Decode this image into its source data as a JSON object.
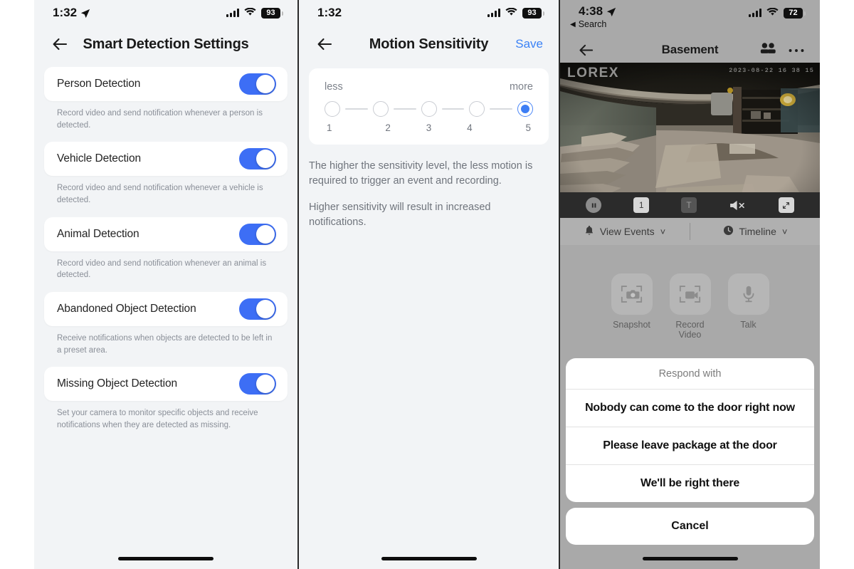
{
  "panels": {
    "smart_detection": {
      "status_bar": {
        "time": "1:32",
        "battery": "93"
      },
      "nav": {
        "title": "Smart Detection Settings",
        "back_icon": "back-arrow-icon"
      },
      "items": [
        {
          "label": "Person Detection",
          "enabled": true,
          "description": "Record video and send notification whenever a person is detected."
        },
        {
          "label": "Vehicle Detection",
          "enabled": true,
          "description": "Record video and send notification whenever a vehicle is detected."
        },
        {
          "label": "Animal Detection",
          "enabled": true,
          "description": "Record video and send notification whenever an animal is detected."
        },
        {
          "label": "Abandoned Object Detection",
          "enabled": true,
          "description": "Receive notifications when objects are detected to be left in a preset area."
        },
        {
          "label": "Missing Object Detection",
          "enabled": true,
          "description": "Set your camera to monitor specific objects and receive notifications when they are detected as missing."
        }
      ]
    },
    "motion_sensitivity": {
      "status_bar": {
        "time": "1:32",
        "battery": "93"
      },
      "nav": {
        "title": "Motion Sensitivity",
        "save_label": "Save",
        "back_icon": "back-arrow-icon"
      },
      "scale": {
        "less_label": "less",
        "more_label": "more",
        "levels": [
          "1",
          "2",
          "3",
          "4",
          "5"
        ],
        "selected": "5"
      },
      "body": {
        "paragraph_1": "The higher the sensitivity level, the less motion is required to trigger an event and recording.",
        "paragraph_2": "Higher sensitivity will result in increased notifications."
      }
    },
    "camera_live": {
      "status_bar": {
        "time": "4:38",
        "battery": "72",
        "back_app": "Search"
      },
      "nav": {
        "title": "Basement",
        "back_icon": "back-arrow-icon",
        "people_icon": "people-icon",
        "more_icon": "more-dots-icon"
      },
      "video": {
        "brand_watermark": "LOREX",
        "timestamp": "2023-08-22 16 38 15"
      },
      "video_controls": [
        {
          "name": "pause-button",
          "glyph": "❙❙"
        },
        {
          "name": "channel-button",
          "glyph": "1"
        },
        {
          "name": "text-overlay-button",
          "glyph": "T"
        },
        {
          "name": "mute-button",
          "glyph": "mute"
        },
        {
          "name": "fullscreen-button",
          "glyph": "expand"
        }
      ],
      "tabs": [
        {
          "label": "View Events",
          "icon": "bell-icon",
          "chevron": "ˇ"
        },
        {
          "label": "Timeline",
          "icon": "clock-icon",
          "chevron": "ˇ"
        }
      ],
      "actions": [
        {
          "label": "Snapshot",
          "icon": "camera-icon"
        },
        {
          "label": "Record Video",
          "icon": "video-camera-icon"
        },
        {
          "label": "Talk",
          "icon": "microphone-icon"
        }
      ],
      "action_sheet": {
        "title": "Respond with",
        "options": [
          "Nobody can come to the door right now",
          "Please leave package at the door",
          "We'll be right there"
        ],
        "cancel_label": "Cancel"
      }
    }
  },
  "colors": {
    "toggle_on": "#3d6ef5",
    "accent_link": "#3b82f6",
    "selected_dot": "#3d7ef5",
    "panel_bg": "#f2f4f6",
    "dim_overlay": "#a9a9a9"
  }
}
